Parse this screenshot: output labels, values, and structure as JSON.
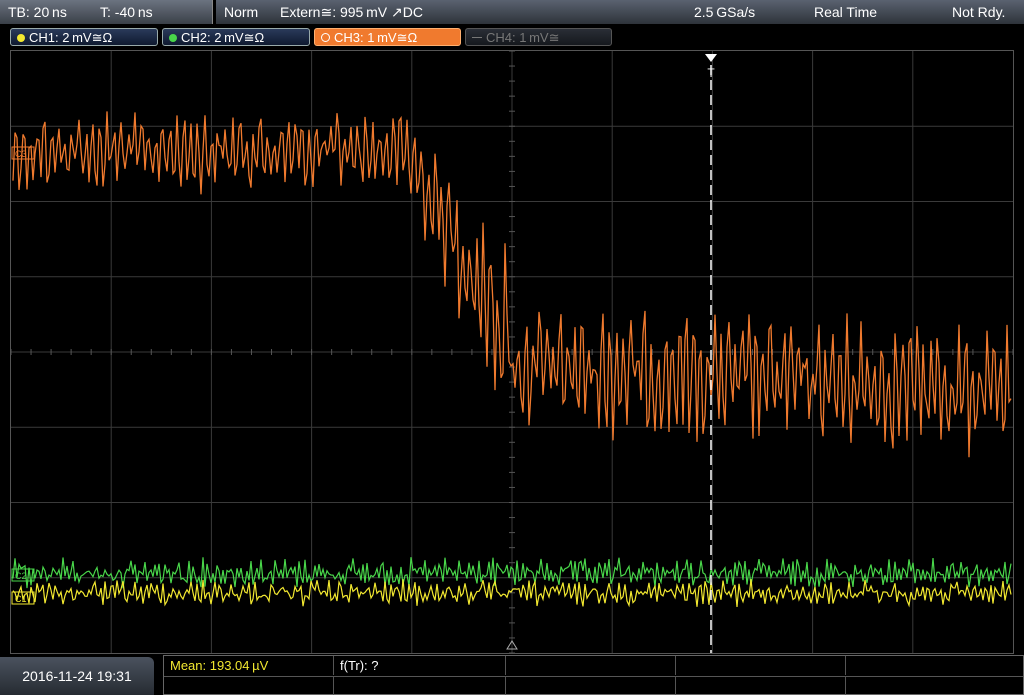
{
  "topbar": {
    "timebase": "TB: 20 ns",
    "trigger_offset": "T: -40 ns",
    "mode": "Norm",
    "trigger": "Extern≅: 995 mV ↗DC",
    "sample_rate": "2.5 GSa/s",
    "acq_mode": "Real Time",
    "status": "Not Rdy."
  },
  "channels": [
    {
      "label": "CH1: 2 mV≅Ω",
      "color": "#f2e830",
      "state": "on"
    },
    {
      "label": "CH2: 2 mV≅Ω",
      "color": "#49d64a",
      "state": "on"
    },
    {
      "label": "CH3: 1 mV≅Ω",
      "color": "#f07a2e",
      "state": "active"
    },
    {
      "label": "CH4: 1 mV≅",
      "color": "#777777",
      "state": "off"
    }
  ],
  "markers": {
    "trigger_marker": "T",
    "ch3_ref": "C3",
    "ch2_ref": "C2",
    "ch1_ref": "C1"
  },
  "bottombar": {
    "datetime": "2016-11-24 19:31",
    "measurement_1": "Mean: 193.04 µV",
    "measurement_2": "f(Tr): ?"
  },
  "colors": {
    "ch1": "#f2e830",
    "ch2": "#49d64a",
    "ch3": "#f07a2e",
    "grid": "#3a3a3a"
  }
}
